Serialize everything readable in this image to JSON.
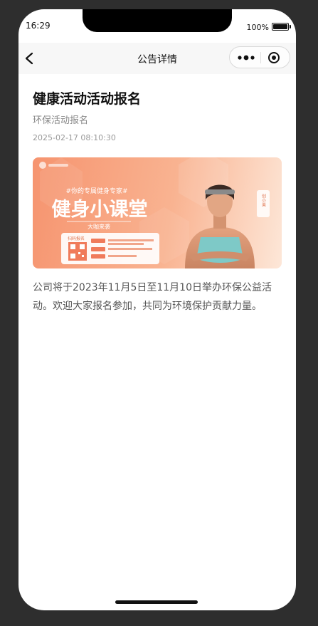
{
  "status_bar": {
    "time": "16:29",
    "battery_text": "100%"
  },
  "nav": {
    "title": "公告详情",
    "back_icon": "chevron-left-icon",
    "more_icon": "more-dots-icon",
    "close_icon": "target-circle-icon"
  },
  "article": {
    "title": "健康活动活动报名",
    "subtitle": "环保活动报名",
    "date": "2025-02-17 08:10:30",
    "body": "公司将于2023年11月5日至11月10日举办环保公益活动。欢迎大家报名参加，共同为环境保护贡献力量。"
  },
  "banner": {
    "tagline": "#你的专属健身专家#",
    "headline": "健身小课堂",
    "ribbon": "大咖来袭",
    "qr_label": "扫码报名",
    "side_tag": "创小美",
    "colors": {
      "accent": "#f6946f",
      "light": "#fde7d8"
    }
  }
}
